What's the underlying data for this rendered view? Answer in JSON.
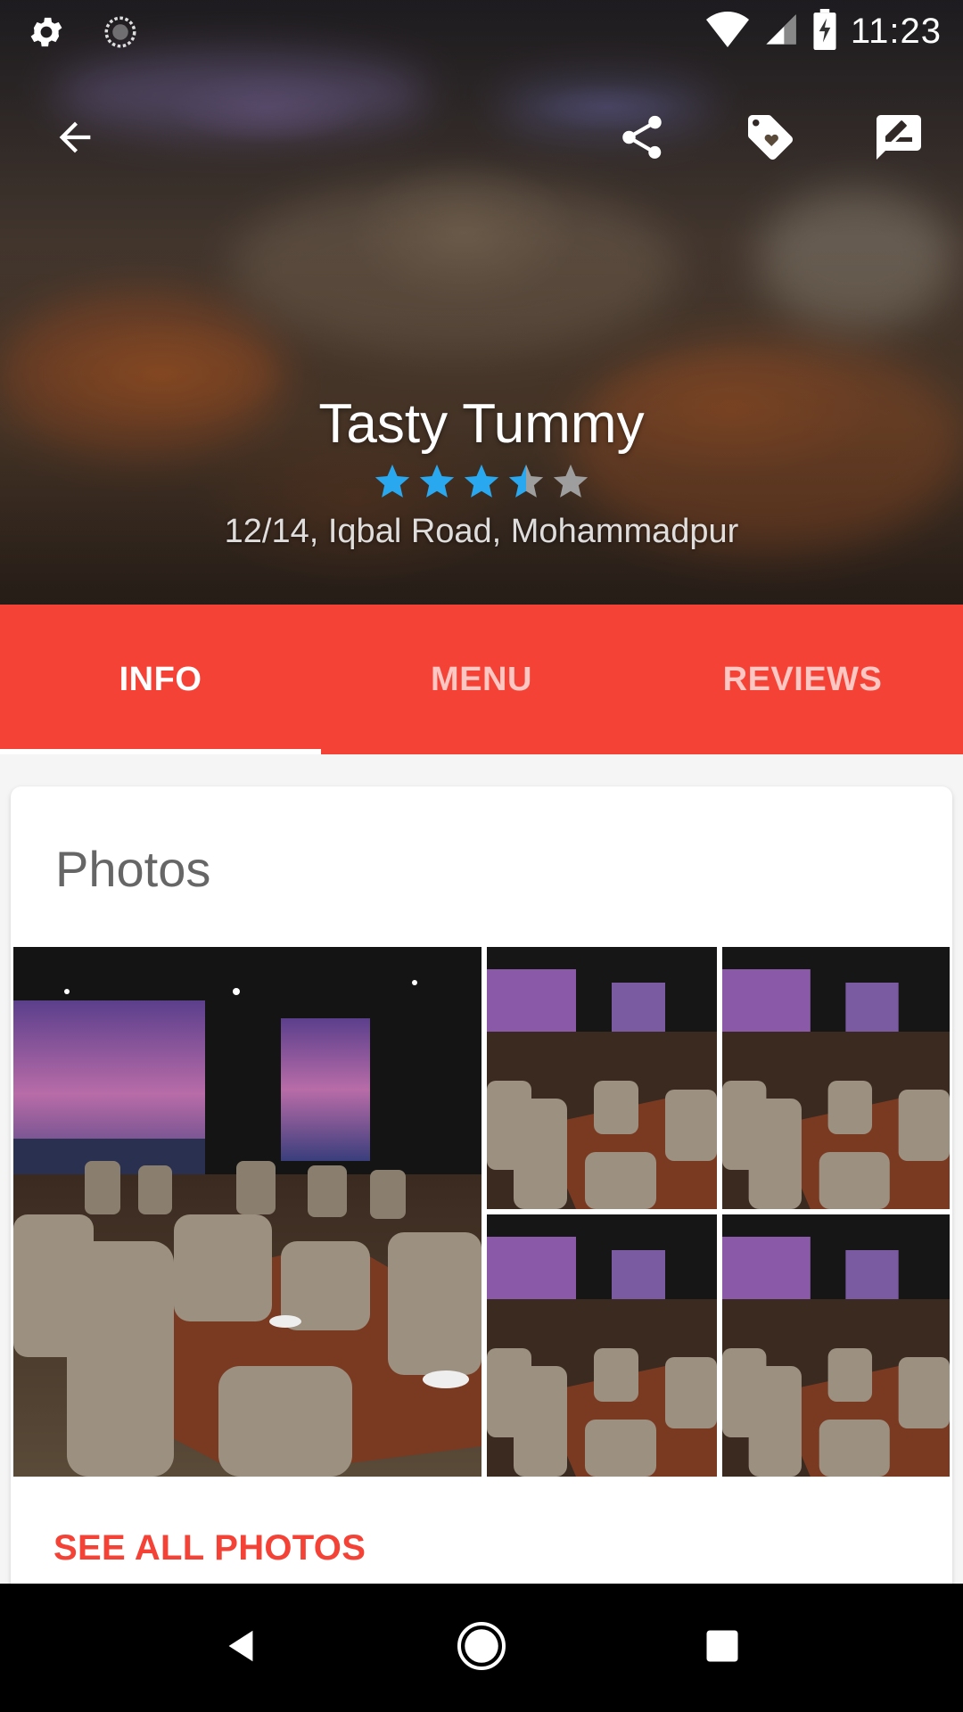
{
  "status_bar": {
    "time": "11:23",
    "icons": [
      "settings-icon",
      "sync-icon",
      "wifi-icon",
      "cell-signal-icon",
      "battery-charging-icon"
    ]
  },
  "app_bar": {
    "actions": [
      "back-arrow-icon",
      "share-icon",
      "tag-favorite-icon",
      "rate-review-icon"
    ]
  },
  "restaurant": {
    "name": "Tasty Tummy",
    "rating": 3.5,
    "rating_max": 5,
    "address": "12/14, Iqbal Road, Mohammadpur"
  },
  "tabs": [
    {
      "label": "INFO",
      "active": true
    },
    {
      "label": "MENU",
      "active": false
    },
    {
      "label": "REVIEWS",
      "active": false
    }
  ],
  "photos_card": {
    "title": "Photos",
    "see_all_label": "SEE ALL PHOTOS",
    "photo_count_shown": 5
  },
  "colors": {
    "accent": "#f44336",
    "star": "#29a8ef",
    "star_empty": "#9e9e9e",
    "nav_bar": "#000000"
  }
}
